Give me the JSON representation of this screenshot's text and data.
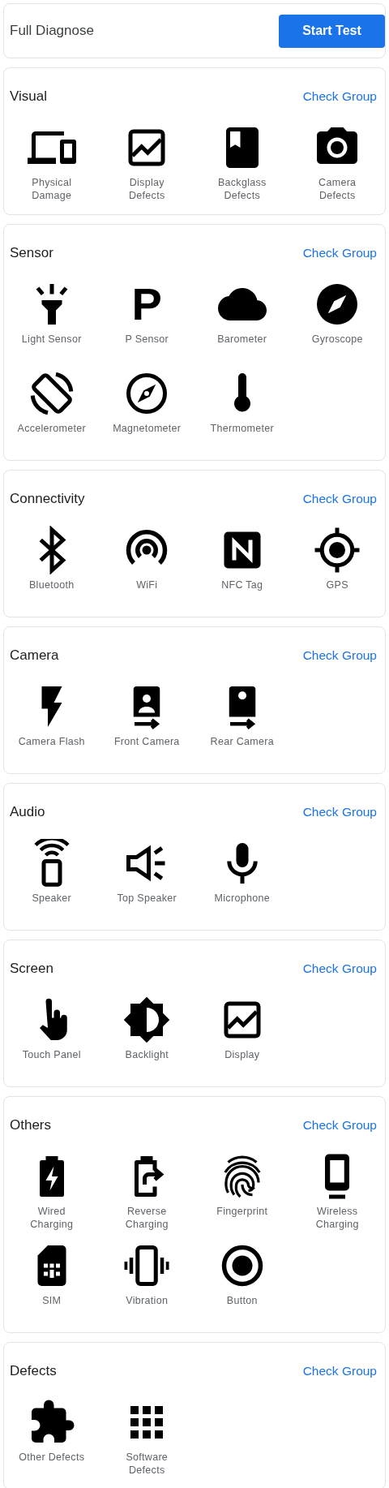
{
  "header": {
    "title": "Full Diagnose",
    "button": "Start Test"
  },
  "groups": [
    {
      "title": "Visual",
      "action": "Check Group",
      "items": [
        {
          "label": "Physical\nDamage"
        },
        {
          "label": "Display\nDefects"
        },
        {
          "label": "Backglass\nDefects"
        },
        {
          "label": "Camera\nDefects"
        }
      ]
    },
    {
      "title": "Sensor",
      "action": "Check Group",
      "items": [
        {
          "label": "Light Sensor"
        },
        {
          "label": "P Sensor",
          "glyph": "P"
        },
        {
          "label": "Barometer"
        },
        {
          "label": "Gyroscope"
        },
        {
          "label": "Accelerometer"
        },
        {
          "label": "Magnetometer"
        },
        {
          "label": "Thermometer"
        }
      ]
    },
    {
      "title": "Connectivity",
      "action": "Check Group",
      "items": [
        {
          "label": "Bluetooth"
        },
        {
          "label": "WiFi"
        },
        {
          "label": "NFC Tag"
        },
        {
          "label": "GPS"
        }
      ]
    },
    {
      "title": "Camera",
      "action": "Check Group",
      "items": [
        {
          "label": "Camera Flash"
        },
        {
          "label": "Front Camera"
        },
        {
          "label": "Rear Camera"
        }
      ]
    },
    {
      "title": "Audio",
      "action": "Check Group",
      "items": [
        {
          "label": "Speaker"
        },
        {
          "label": "Top Speaker"
        },
        {
          "label": "Microphone"
        }
      ]
    },
    {
      "title": "Screen",
      "action": "Check Group",
      "items": [
        {
          "label": "Touch Panel"
        },
        {
          "label": "Backlight"
        },
        {
          "label": "Display"
        }
      ]
    },
    {
      "title": "Others",
      "action": "Check Group",
      "items": [
        {
          "label": "Wired\nCharging"
        },
        {
          "label": "Reverse\nCharging"
        },
        {
          "label": "Fingerprint"
        },
        {
          "label": "Wireless\nCharging"
        },
        {
          "label": "SIM"
        },
        {
          "label": "Vibration"
        },
        {
          "label": "Button"
        }
      ]
    },
    {
      "title": "Defects",
      "action": "Check Group",
      "items": [
        {
          "label": "Other Defects"
        },
        {
          "label": "Software\nDefects"
        }
      ]
    }
  ]
}
